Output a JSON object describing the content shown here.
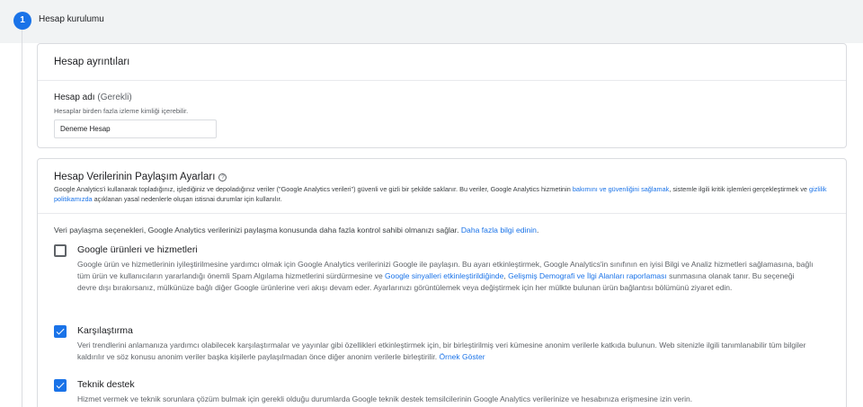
{
  "step": {
    "number": "1",
    "title": "Hesap kurulumu"
  },
  "account_details": {
    "title": "Hesap ayrıntıları",
    "name_label": "Hesap adı",
    "name_required": "(Gerekli)",
    "name_hint": "Hesaplar birden fazla izleme kimliği içerebilir.",
    "name_value": "Deneme Hesap"
  },
  "sharing": {
    "title": "Hesap Verilerinin Paylaşım Ayarları",
    "help_icon": "?",
    "desc_1": "Google Analytics'i kullanarak topladığınız, işlediğiniz ve depoladığınız veriler (\"Google Analytics verileri\") güvenli ve gizli bir şekilde saklanır. Bu veriler, Google Analytics hizmetinin ",
    "desc_link_1": "bakımını ve güvenliğini sağlamak",
    "desc_2": ", sistemle ilgili kritik işlemleri gerçekleştirmek ve ",
    "desc_link_2": "gizlilik politikamızda",
    "desc_3": " açıklanan yasal nedenlerle oluşan istisnai durumlar için kullanılır.",
    "intro_text": "Veri paylaşma seçenekleri, Google Analytics verilerinizi paylaşma konusunda daha fazla kontrol sahibi olmanızı sağlar. ",
    "intro_link": "Daha fazla bilgi edinin",
    "intro_end": ".",
    "options": [
      {
        "title": "Google ürünleri ve hizmetleri",
        "checked": false,
        "desc_1": "Google ürün ve hizmetlerinin iyileştirilmesine yardımcı olmak için Google Analytics verilerinizi Google ile paylaşın. Bu ayarı etkinleştirmek, Google Analytics'in sınıfının en iyisi Bilgi ve Analiz hizmetleri sağlamasına, bağlı tüm ürün ve kullanıcıların yararlandığı önemli Spam Algılama hizmetlerini sürdürmesine ve ",
        "link_1": "Google sinyalleri etkinleştirildiğinde",
        "desc_2": ", ",
        "link_2": "Gelişmiş Demografi ve İlgi Alanları raporlaması",
        "desc_3": " sunmasına olanak tanır. Bu seçeneği devre dışı bırakırsanız, mülkünüze bağlı diğer Google ürünlerine veri akışı devam eder. Ayarlarınızı görüntülemek veya değiştirmek için her mülkte bulunan ürün bağlantısı bölümünü ziyaret edin."
      },
      {
        "title": "Karşılaştırma",
        "checked": true,
        "desc_1": "Veri trendlerini anlamanıza yardımcı olabilecek karşılaştırmalar ve yayınlar gibi özellikleri etkinleştirmek için, bir birleştirilmiş veri kümesine anonim verilerle katkıda bulunun. Web sitenizle ilgili tanımlanabilir tüm bilgiler kaldırılır ve söz konusu anonim veriler başka kişilerle paylaşılmadan önce diğer anonim verilerle birleştirilir.   ",
        "link_1": "Örnek Göster"
      },
      {
        "title": "Teknik destek",
        "checked": true,
        "desc_1": "Hizmet vermek ve teknik sorunlara çözüm bulmak için gerekli olduğu durumlarda Google teknik destek temsilcilerinin Google Analytics verilerinize ve hesabınıza erişmesine izin verin."
      }
    ]
  },
  "colors": {
    "accent": "#1a73e8",
    "topbar": "#f1f3f4",
    "border": "#dadce0"
  }
}
